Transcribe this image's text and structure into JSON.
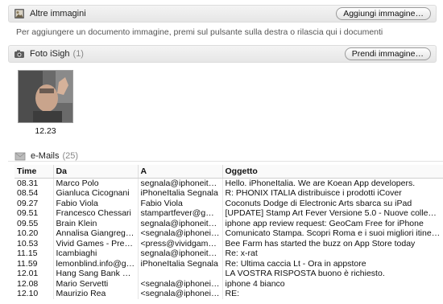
{
  "altre_immagini": {
    "title": "Altre immagini",
    "button_label": "Aggiungi immagine…",
    "hint": "Per aggiungere un documento immagine, premi sul pulsante sulla destra o rilascia qui i documenti"
  },
  "foto_isight": {
    "title": "Foto iSigh",
    "count": "(1)",
    "button_label": "Prendi immagine…",
    "photo_caption": "12.23"
  },
  "emails": {
    "title": "e-Mails",
    "count": "(25)",
    "columns": [
      "Time",
      "Da",
      "A",
      "Oggetto"
    ],
    "rows": [
      {
        "time": "08.31",
        "da": "Marco Polo",
        "a": "segnala@iphoneitali…",
        "oggetto": "Hello. iPhoneItalia. We are Koean App developers."
      },
      {
        "time": "08.54",
        "da": "Gianluca Cicognani",
        "a": "iPhoneItalia Segnala",
        "oggetto": "R: PHONIX ITALIA distribuisce i prodotti iCover"
      },
      {
        "time": "09.27",
        "da": "Fabio Viola",
        "a": "Fabio Viola",
        "oggetto": "Coconuts Dodge di Electronic Arts sbarca su iPad"
      },
      {
        "time": "09.51",
        "da": "Francesco Chessari",
        "a": "stampartfever@gmail…",
        "oggetto": "[UPDATE] Stamp Art Fever Versione 5.0 - Nuove collezioni e…"
      },
      {
        "time": "09.55",
        "da": "Brain Klein",
        "a": "segnala@iphoneitali…",
        "oggetto": "iphone app review request: GeoCam Free for iPhone"
      },
      {
        "time": "10.20",
        "da": "Annalisa Giangregorio",
        "a": "<segnala@iphoneitali…",
        "oggetto": "Comunicato Stampa. Scopri Roma e i suoi migliori itinerari."
      },
      {
        "time": "10.53",
        "da": "Vivid Games - Press …",
        "a": "<press@vividgames.…",
        "oggetto": "Bee Farm has started the buzz on App Store today"
      },
      {
        "time": "11.15",
        "da": "Icambiaghi",
        "a": "segnala@iphoneitali…",
        "oggetto": "Re: x-rat"
      },
      {
        "time": "11.59",
        "da": "lemonblind.info@gm…",
        "a": "iPhoneItalia Segnala",
        "oggetto": "Re: Ultima caccia Lt - Ora in appstore"
      },
      {
        "time": "12.01",
        "da": "Hang Sang Bank Limited",
        "a": "",
        "oggetto": "LA VOSTRA RISPOSTA buono è richiesto."
      },
      {
        "time": "12.08",
        "da": "Mario Servetti",
        "a": "<segnala@iphoneitali…",
        "oggetto": "iphone 4 bianco"
      },
      {
        "time": "12.10",
        "da": "Maurizio Rea",
        "a": "<segnala@iphoneitali…",
        "oggetto": "RE:"
      }
    ]
  }
}
